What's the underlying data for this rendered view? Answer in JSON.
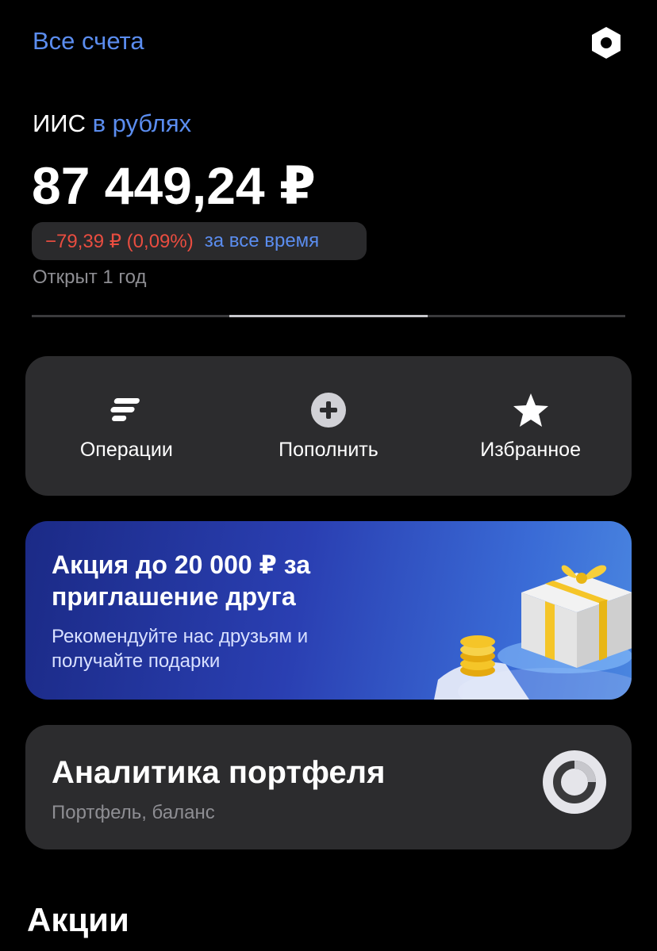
{
  "header": {
    "all_accounts": "Все счета",
    "settings_icon": "hexagon-settings-icon"
  },
  "account": {
    "type": "ИИС",
    "currency_link": "в рублях",
    "balance": "87 449,24 ₽",
    "pnl_value": "−79,39 ₽ (0,09%)",
    "pnl_period": "за все время",
    "opened": "Открыт 1 год",
    "pager": {
      "pages": 3,
      "active_index": 1
    }
  },
  "actions": [
    {
      "label": "Операции",
      "icon": "operations-icon"
    },
    {
      "label": "Пополнить",
      "icon": "plus-circle-icon"
    },
    {
      "label": "Избранное",
      "icon": "star-icon"
    }
  ],
  "promo": {
    "title": "Акция до 20 000 ₽ за приглашение друга",
    "subtitle": "Рекомендуйте нас друзьям и получайте подарки",
    "art": "gift-box-coins-illustration"
  },
  "analytics": {
    "title": "Аналитика портфеля",
    "subtitle": "Портфель, баланс",
    "icon": "donut-chart-icon"
  },
  "sections": {
    "stocks_title": "Акции"
  },
  "colors": {
    "accent": "#5b8def",
    "negative": "#e94d40",
    "card_bg": "#2c2c2e",
    "background": "#000000"
  }
}
